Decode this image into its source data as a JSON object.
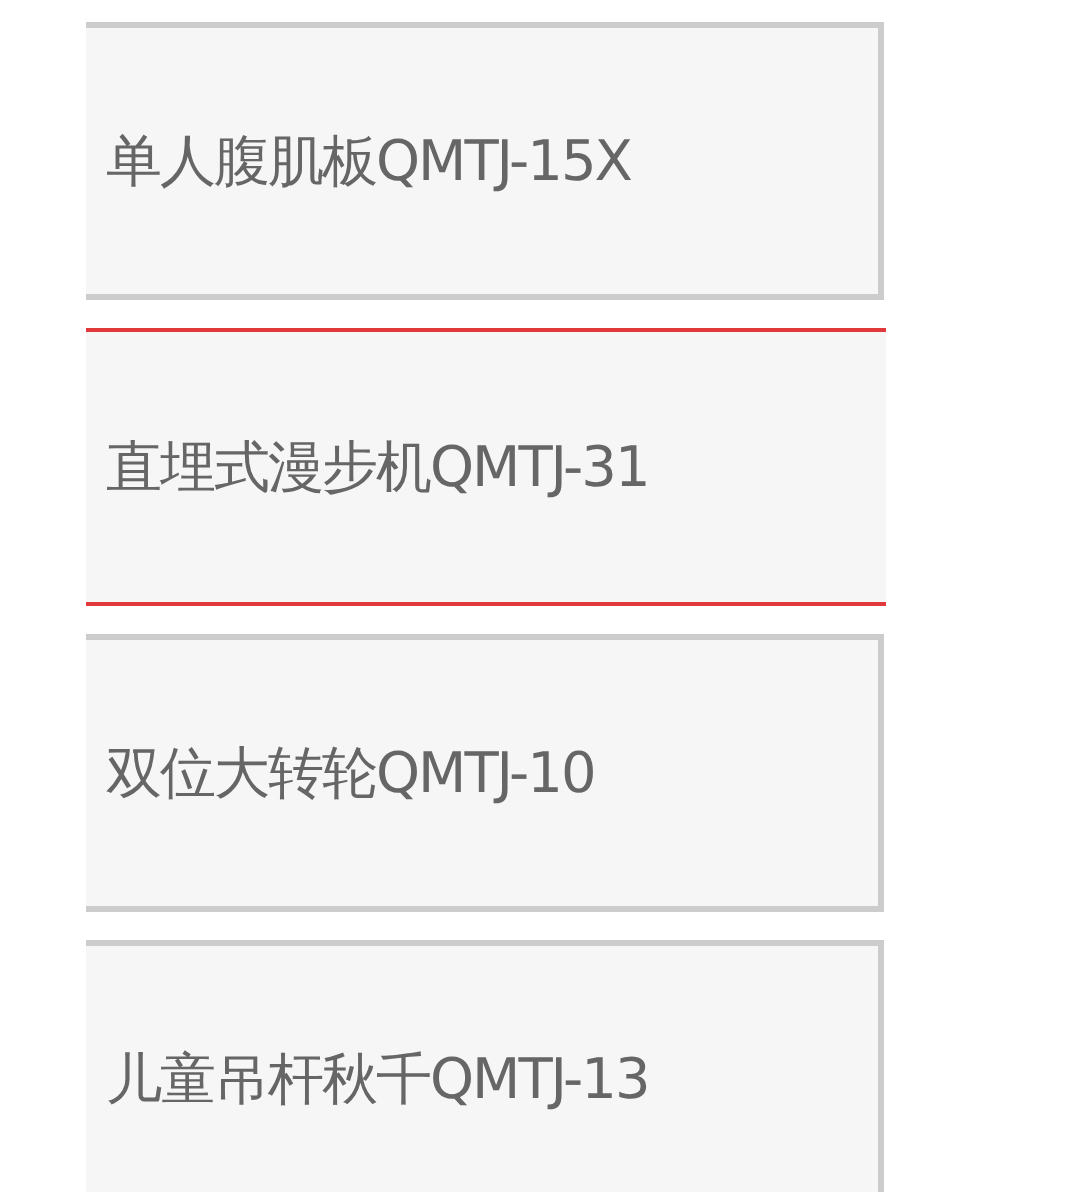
{
  "products": [
    {
      "label": "单人腹肌板QMTJ-15X",
      "selected": false
    },
    {
      "label": "直埋式漫步机QMTJ-31",
      "selected": true
    },
    {
      "label": "双位大转轮QMTJ-10",
      "selected": false
    },
    {
      "label": "儿童吊杆秋千QMTJ-13",
      "selected": false
    }
  ]
}
